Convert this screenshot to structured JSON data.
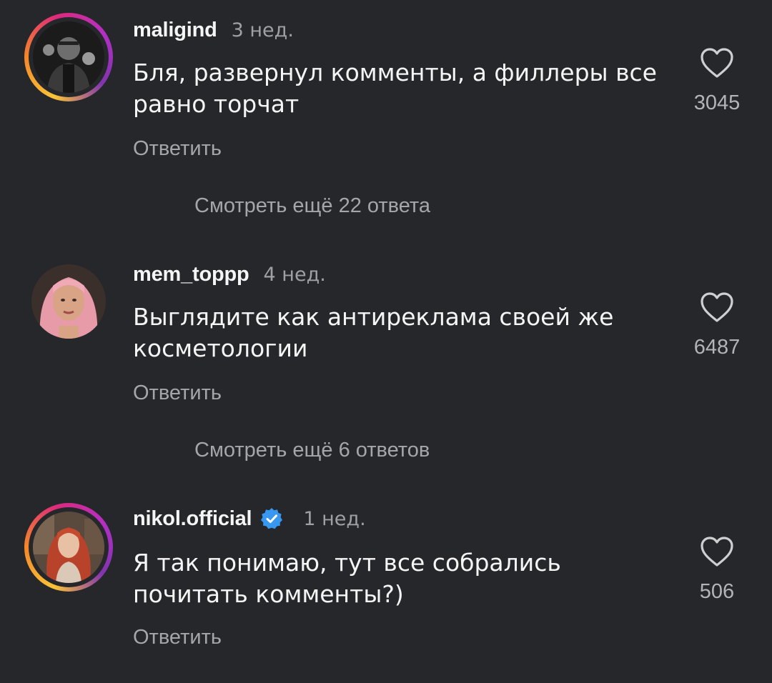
{
  "comments": [
    {
      "username": "maligind",
      "time": "3 нед.",
      "text_line1": "Бля, развернул комменты, а филлеры все",
      "text_line2": "равно торчат",
      "reply_label": "Ответить",
      "likes": "3045",
      "view_replies": "Смотреть ещё 22 ответа",
      "avatar_icon": "avatar-maligind",
      "has_story_ring": true
    },
    {
      "username": "mem_toppp",
      "time": "4 нед.",
      "text_line1": "Выглядите как антиреклама своей же",
      "text_line2": "косметологии",
      "reply_label": "Ответить",
      "likes": "6487",
      "view_replies": "Смотреть ещё 6 ответов",
      "avatar_icon": "avatar-mem-toppp",
      "has_story_ring": false
    },
    {
      "username": "nikol.official",
      "time": "1 нед.",
      "text_line1": "Я так понимаю, тут все собрались",
      "text_line2": "почитать комменты?)",
      "reply_label": "Ответить",
      "likes": "506",
      "verified": true,
      "avatar_icon": "avatar-nikol-official",
      "has_story_ring": true
    }
  ],
  "colors": {
    "background": "#26272b",
    "primary_text": "#f5f5f5",
    "secondary_text": "#a6a6aa",
    "verified_blue": "#3897f0"
  },
  "icons": {
    "like": "heart-outline-icon",
    "verified": "verified-badge-icon"
  }
}
